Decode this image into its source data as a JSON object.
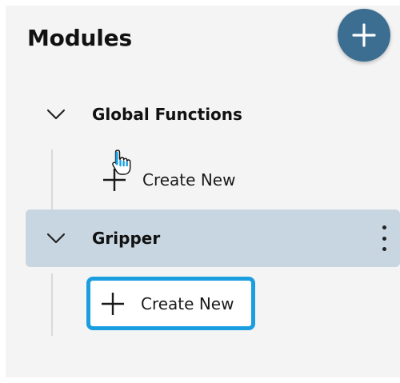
{
  "panel": {
    "title": "Modules",
    "add_button_icon": "plus-icon"
  },
  "groups": [
    {
      "name": "Global Functions",
      "expanded": true,
      "selected": false,
      "create_label": "Create New",
      "icons": {
        "toggle": "chevron-down-icon",
        "create": "plus-icon"
      }
    },
    {
      "name": "Gripper",
      "expanded": true,
      "selected": true,
      "create_label": "Create New",
      "icons": {
        "toggle": "chevron-down-icon",
        "menu": "kebab-menu-icon",
        "create": "plus-icon"
      }
    }
  ],
  "colors": {
    "panel_bg": "#f4f4f5",
    "fab": "#3b6e91",
    "selected_row": "#c7d6e1",
    "focus_ring": "#1a9ee0"
  },
  "pointer_icon": "hand-pointer-icon"
}
